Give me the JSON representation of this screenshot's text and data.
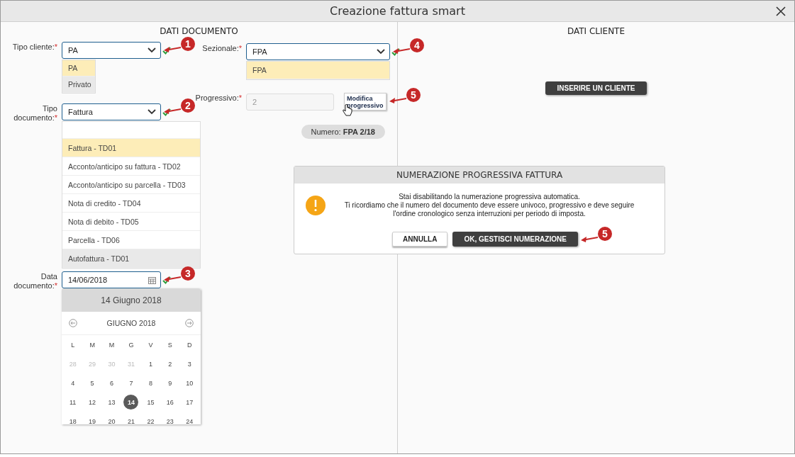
{
  "window": {
    "title": "Creazione fattura smart"
  },
  "document_section": {
    "title": "DATI DOCUMENTO",
    "tipo_cliente": {
      "label": "Tipo cliente:",
      "required_mark": "*",
      "value": "PA",
      "valid": true,
      "callout": "1",
      "options": [
        {
          "label": "PA",
          "selected": true,
          "highlighted": false
        },
        {
          "label": "Privato",
          "selected": false,
          "highlighted": true
        }
      ]
    },
    "tipo_documento": {
      "label": "Tipo documento:",
      "required_mark": "*",
      "value": "Fattura",
      "valid": true,
      "callout": "2",
      "has_empty_option": true,
      "options": [
        {
          "label": "Fattura - TD01",
          "selected": true,
          "highlighted": false
        },
        {
          "label": "Acconto/anticipo su fattura - TD02",
          "selected": false,
          "highlighted": false
        },
        {
          "label": "Acconto/anticipo su parcella - TD03",
          "selected": false,
          "highlighted": false
        },
        {
          "label": "Nota di credito - TD04",
          "selected": false,
          "highlighted": false
        },
        {
          "label": "Nota di debito - TD05",
          "selected": false,
          "highlighted": false
        },
        {
          "label": "Parcella - TD06",
          "selected": false,
          "highlighted": false
        },
        {
          "label": "Autofattura - TD01",
          "selected": false,
          "highlighted": true
        }
      ]
    },
    "data_documento": {
      "label": "Data documento:",
      "required_mark": "*",
      "value": "14/06/2018",
      "valid": true,
      "callout": "3",
      "calendar": {
        "title": "14 Giugno 2018",
        "month": "GIUGNO 2018",
        "weekdays": [
          "L",
          "M",
          "M",
          "G",
          "V",
          "S",
          "D"
        ],
        "weeks": [
          [
            {
              "d": "28",
              "outside": true,
              "selected": false
            },
            {
              "d": "29",
              "outside": true,
              "selected": false
            },
            {
              "d": "30",
              "outside": true,
              "selected": false
            },
            {
              "d": "31",
              "outside": true,
              "selected": false
            },
            {
              "d": "1",
              "outside": false,
              "selected": false
            },
            {
              "d": "2",
              "outside": false,
              "selected": false
            },
            {
              "d": "3",
              "outside": false,
              "selected": false
            }
          ],
          [
            {
              "d": "4",
              "outside": false,
              "selected": false
            },
            {
              "d": "5",
              "outside": false,
              "selected": false
            },
            {
              "d": "6",
              "outside": false,
              "selected": false
            },
            {
              "d": "7",
              "outside": false,
              "selected": false
            },
            {
              "d": "8",
              "outside": false,
              "selected": false
            },
            {
              "d": "9",
              "outside": false,
              "selected": false
            },
            {
              "d": "10",
              "outside": false,
              "selected": false
            }
          ],
          [
            {
              "d": "11",
              "outside": false,
              "selected": false
            },
            {
              "d": "12",
              "outside": false,
              "selected": false
            },
            {
              "d": "13",
              "outside": false,
              "selected": false
            },
            {
              "d": "14",
              "outside": false,
              "selected": true
            },
            {
              "d": "15",
              "outside": false,
              "selected": false
            },
            {
              "d": "16",
              "outside": false,
              "selected": false
            },
            {
              "d": "17",
              "outside": false,
              "selected": false
            }
          ],
          [
            {
              "d": "18",
              "outside": false,
              "selected": false
            },
            {
              "d": "19",
              "outside": false,
              "selected": false
            },
            {
              "d": "20",
              "outside": false,
              "selected": false
            },
            {
              "d": "21",
              "outside": false,
              "selected": false
            },
            {
              "d": "22",
              "outside": false,
              "selected": false
            },
            {
              "d": "23",
              "outside": false,
              "selected": false
            },
            {
              "d": "24",
              "outside": false,
              "selected": false
            }
          ]
        ]
      }
    },
    "sezionale": {
      "label": "Sezionale:",
      "required_mark": "*",
      "value": "FPA",
      "valid": true,
      "callout": "4",
      "options": [
        {
          "label": "FPA",
          "selected": true
        }
      ]
    },
    "progressivo": {
      "label": "Progressivo:",
      "required_mark": "*",
      "value": "2",
      "disabled": true,
      "button": "Modifica progressivo",
      "callout": "5"
    },
    "numero": "Numero: **FPA 2/18**"
  },
  "client_section": {
    "title": "DATI CLIENTE",
    "button": "INSERIRE UN CLIENTE"
  },
  "dialog": {
    "title": "NUMERAZIONE PROGRESSIVA FATTURA",
    "message": [
      "Stai disabilitando la numerazione progressiva automatica.",
      "Ti ricordiamo che il numero del documento deve essere univoco, progressivo e deve seguire",
      "l'ordine cronologico senza interruzioni per periodo di imposta."
    ],
    "buttons": [
      {
        "label": "ANNULLA",
        "kind": "secondary"
      },
      {
        "label": "OK, GESTISCI NUMERAZIONE",
        "kind": "primary",
        "callout": "5"
      }
    ]
  }
}
